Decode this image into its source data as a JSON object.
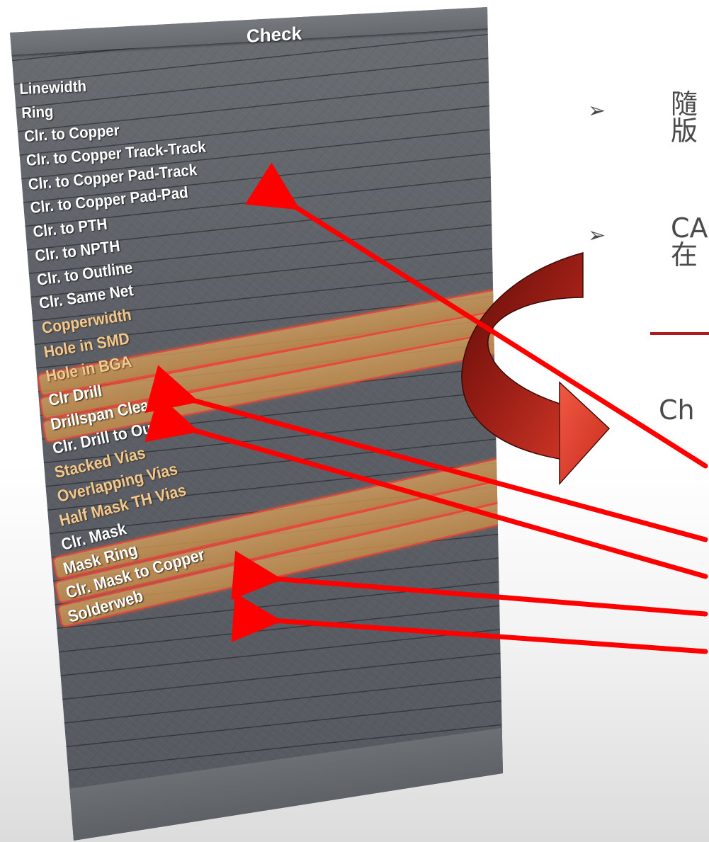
{
  "panel": {
    "title": "Check",
    "items": [
      {
        "label": "Linewidth",
        "highlighted": false
      },
      {
        "label": "Ring",
        "highlighted": false
      },
      {
        "label": "Clr. to Copper",
        "highlighted": false
      },
      {
        "label": "Clr. to Copper Track-Track",
        "highlighted": false
      },
      {
        "label": "Clr. to Copper Pad-Track",
        "highlighted": false
      },
      {
        "label": "Clr. to Copper Pad-Pad",
        "highlighted": false
      },
      {
        "label": "Clr. to PTH",
        "highlighted": false
      },
      {
        "label": "Clr. to NPTH",
        "highlighted": false
      },
      {
        "label": "Clr. to Outline",
        "highlighted": false
      },
      {
        "label": "Clr. Same Net",
        "highlighted": false
      },
      {
        "label": "Copperwidth",
        "highlighted": true
      },
      {
        "label": "Hole in SMD",
        "highlighted": true
      },
      {
        "label": "Hole in BGA",
        "highlighted": true
      },
      {
        "label": "Clr Drill",
        "highlighted": false
      },
      {
        "label": "Drillspan Clearance",
        "highlighted": false
      },
      {
        "label": "Clr. Drill to Outline",
        "highlighted": false
      },
      {
        "label": "Stacked Vias",
        "highlighted": true
      },
      {
        "label": "Overlapping Vias",
        "highlighted": true
      },
      {
        "label": "Half Mask TH Vias",
        "highlighted": true
      },
      {
        "label": "Clr. Mask",
        "highlighted": false
      },
      {
        "label": "Mask Ring",
        "highlighted": false
      },
      {
        "label": "Clr. Mask to Copper",
        "highlighted": false
      },
      {
        "label": "Solderweb",
        "highlighted": false
      }
    ]
  },
  "slide": {
    "bullet_symbol": "➢",
    "bullet1": {
      "line1": "隨",
      "line2": "版"
    },
    "bullet2": {
      "line1": "CA",
      "line2": "在"
    },
    "section_text": "Ch"
  },
  "colors": {
    "arrow_red": "#ff0000",
    "divider_red": "#b0191c",
    "highlight_fill": "#d49e5c",
    "highlight_border": "#e8483a",
    "curved_arrow_dark": "#7a1410",
    "curved_arrow_light": "#e04030"
  },
  "icons": {
    "curved_arrow": "curved-arrow-icon",
    "bullet": "bullet-arrow-icon"
  }
}
